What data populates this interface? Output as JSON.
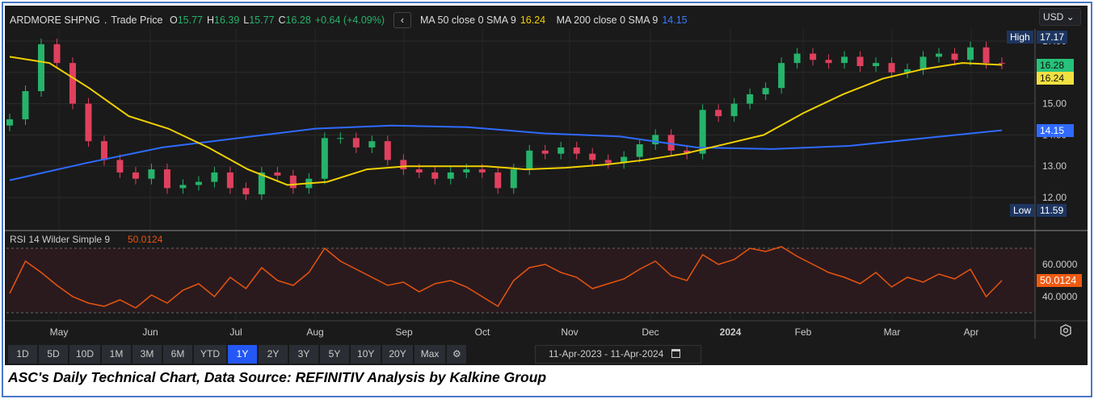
{
  "header": {
    "symbol": "ARDMORE SHPNG",
    "dot": ".",
    "source": "Trade Price",
    "o_label": "O",
    "o": "15.77",
    "h_label": "H",
    "h": "16.39",
    "l_label": "L",
    "l": "15.77",
    "c_label": "C",
    "c": "16.28",
    "change": "+0.64 (+4.09%)",
    "collapse": "‹",
    "ma50_label": "MA 50 close 0 SMA 9",
    "ma50": "16.24",
    "ma200_label": "MA 200 close 0 SMA 9",
    "ma200": "14.15"
  },
  "currency": "USD ⌄",
  "price_axis": {
    "ticks": [
      "17.00",
      "16.00",
      "15.00",
      "14.00",
      "13.00",
      "12.00"
    ],
    "high_label": "High",
    "high": "17.17",
    "low_label": "Low",
    "low": "11.59",
    "last": "16.28",
    "ma50": "16.24",
    "ma200": "14.15"
  },
  "rsi": {
    "label": "RSI 14 Wilder Simple 9",
    "value": "50.0124",
    "ticks": [
      "60.0000",
      "40.0000"
    ]
  },
  "time_axis": [
    "May",
    "Jun",
    "Jul",
    "Aug",
    "Sep",
    "Oct",
    "Nov",
    "Dec",
    "2024",
    "Feb",
    "Mar",
    "Apr"
  ],
  "ranges": [
    "1D",
    "5D",
    "10D",
    "1M",
    "3M",
    "6M",
    "YTD",
    "1Y",
    "2Y",
    "3Y",
    "5Y",
    "10Y",
    "20Y",
    "Max"
  ],
  "active_range": "1Y",
  "date_range": {
    "from": "11-Apr-2023",
    "sep": "-",
    "to": "11-Apr-2024"
  },
  "caption": "ASC's Daily Technical Chart, Data Source: REFINITIV  Analysis by Kalkine Group",
  "colors": {
    "up": "#26b36b",
    "down": "#e0405e",
    "ma50": "#f0d000",
    "ma200": "#2f6bff",
    "rsi": "#e8540f"
  },
  "chart_data": {
    "type": "candlestick",
    "title": "ARDMORE SHPNG . Trade Price",
    "ylim": [
      11.4,
      17.4
    ],
    "closes": [
      14.5,
      15.4,
      16.9,
      16.3,
      15.0,
      13.8,
      13.2,
      12.8,
      12.6,
      12.9,
      12.3,
      12.4,
      12.5,
      12.8,
      12.3,
      12.1,
      12.8,
      12.7,
      12.3,
      12.6,
      13.9,
      13.9,
      13.6,
      13.8,
      13.2,
      12.9,
      12.8,
      12.6,
      12.8,
      12.9,
      12.8,
      12.3,
      12.9,
      13.5,
      13.4,
      13.6,
      13.4,
      13.2,
      13.1,
      13.3,
      13.7,
      14.0,
      13.5,
      13.4,
      14.8,
      14.6,
      15.0,
      15.3,
      15.5,
      16.3,
      16.6,
      16.4,
      16.3,
      16.5,
      16.2,
      16.3,
      16.0,
      16.1,
      16.5,
      16.6,
      16.4,
      16.8,
      16.3,
      16.28
    ],
    "ma50": [
      16.5,
      16.3,
      15.5,
      14.6,
      14.2,
      13.6,
      12.9,
      12.4,
      12.5,
      12.9,
      13.0,
      13.0,
      13.0,
      12.9,
      12.95,
      13.05,
      13.2,
      13.4,
      13.7,
      14.0,
      14.7,
      15.3,
      15.8,
      16.1,
      16.3,
      16.24
    ],
    "ma200": [
      12.55,
      13.1,
      13.6,
      13.9,
      14.2,
      14.3,
      14.25,
      14.05,
      13.95,
      13.6,
      13.55,
      13.65,
      13.9,
      14.15
    ],
    "rsi_ylim": [
      25,
      75
    ],
    "rsi_values": [
      42,
      62,
      55,
      47,
      40,
      36,
      34,
      38,
      33,
      41,
      36,
      44,
      48,
      40,
      52,
      45,
      58,
      50,
      47,
      55,
      70,
      62,
      57,
      52,
      47,
      49,
      43,
      48,
      50,
      46,
      40,
      34,
      50,
      58,
      60,
      55,
      52,
      45,
      48,
      51,
      57,
      62,
      53,
      50,
      66,
      60,
      63,
      70,
      68,
      71,
      65,
      60,
      55,
      52,
      48,
      55,
      46,
      52,
      49,
      54,
      51,
      57,
      40,
      50
    ]
  }
}
